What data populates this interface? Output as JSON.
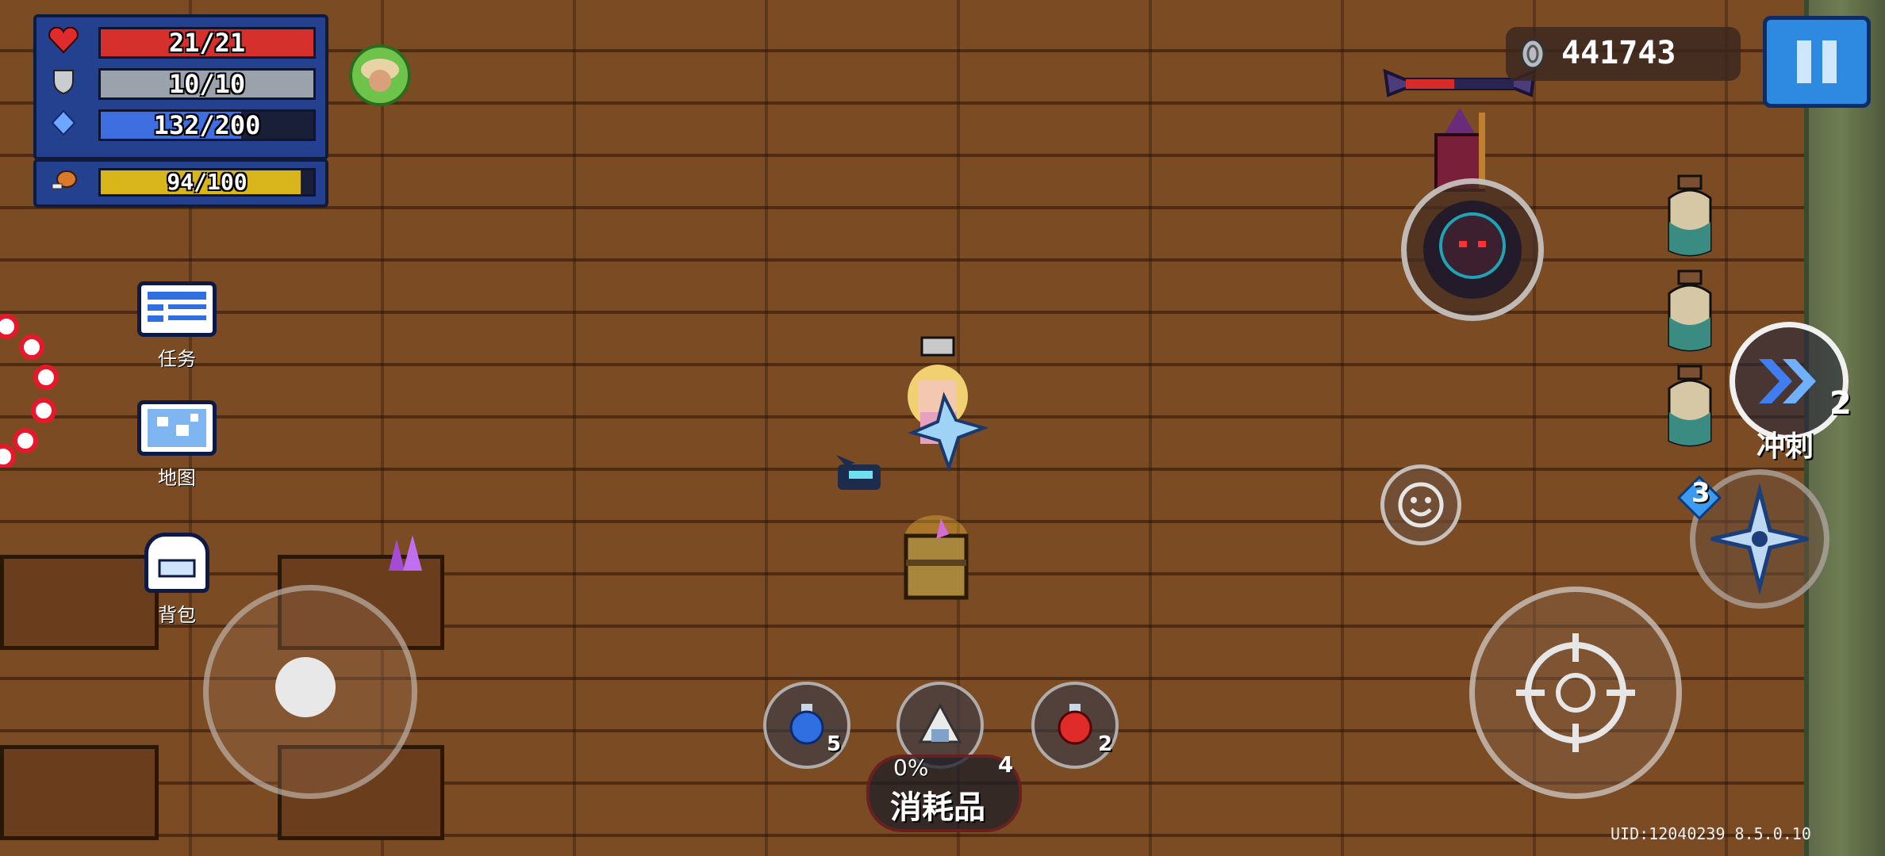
{
  "hud": {
    "health": "21/21",
    "health_fraction": 1.0,
    "armor": "10/10",
    "armor_fraction": 1.0,
    "energy": "132/200",
    "energy_fraction": 0.66,
    "hunger": "94/100",
    "hunger_fraction": 0.94
  },
  "coins": "441743",
  "boss_health_fraction": 0.45,
  "side_menu": {
    "tasks_label": "任务",
    "map_label": "地图",
    "backpack_label": "背包"
  },
  "skills": {
    "dash_label": "冲刺",
    "dash_count": "2",
    "weapon_ammo": "3"
  },
  "consumables": {
    "blue_potion_count": "5",
    "red_potion_count": "2",
    "slot_count": "4",
    "slot_percent": "0%",
    "slot_label": "消耗品"
  },
  "uid_text": "UID:12040239 8.5.0.10",
  "colors": {
    "health": "#d6302c",
    "armor": "#9aa2ab",
    "energy": "#3f6ee0",
    "hunger": "#d9b51c",
    "hud_panel": "#24418f"
  }
}
